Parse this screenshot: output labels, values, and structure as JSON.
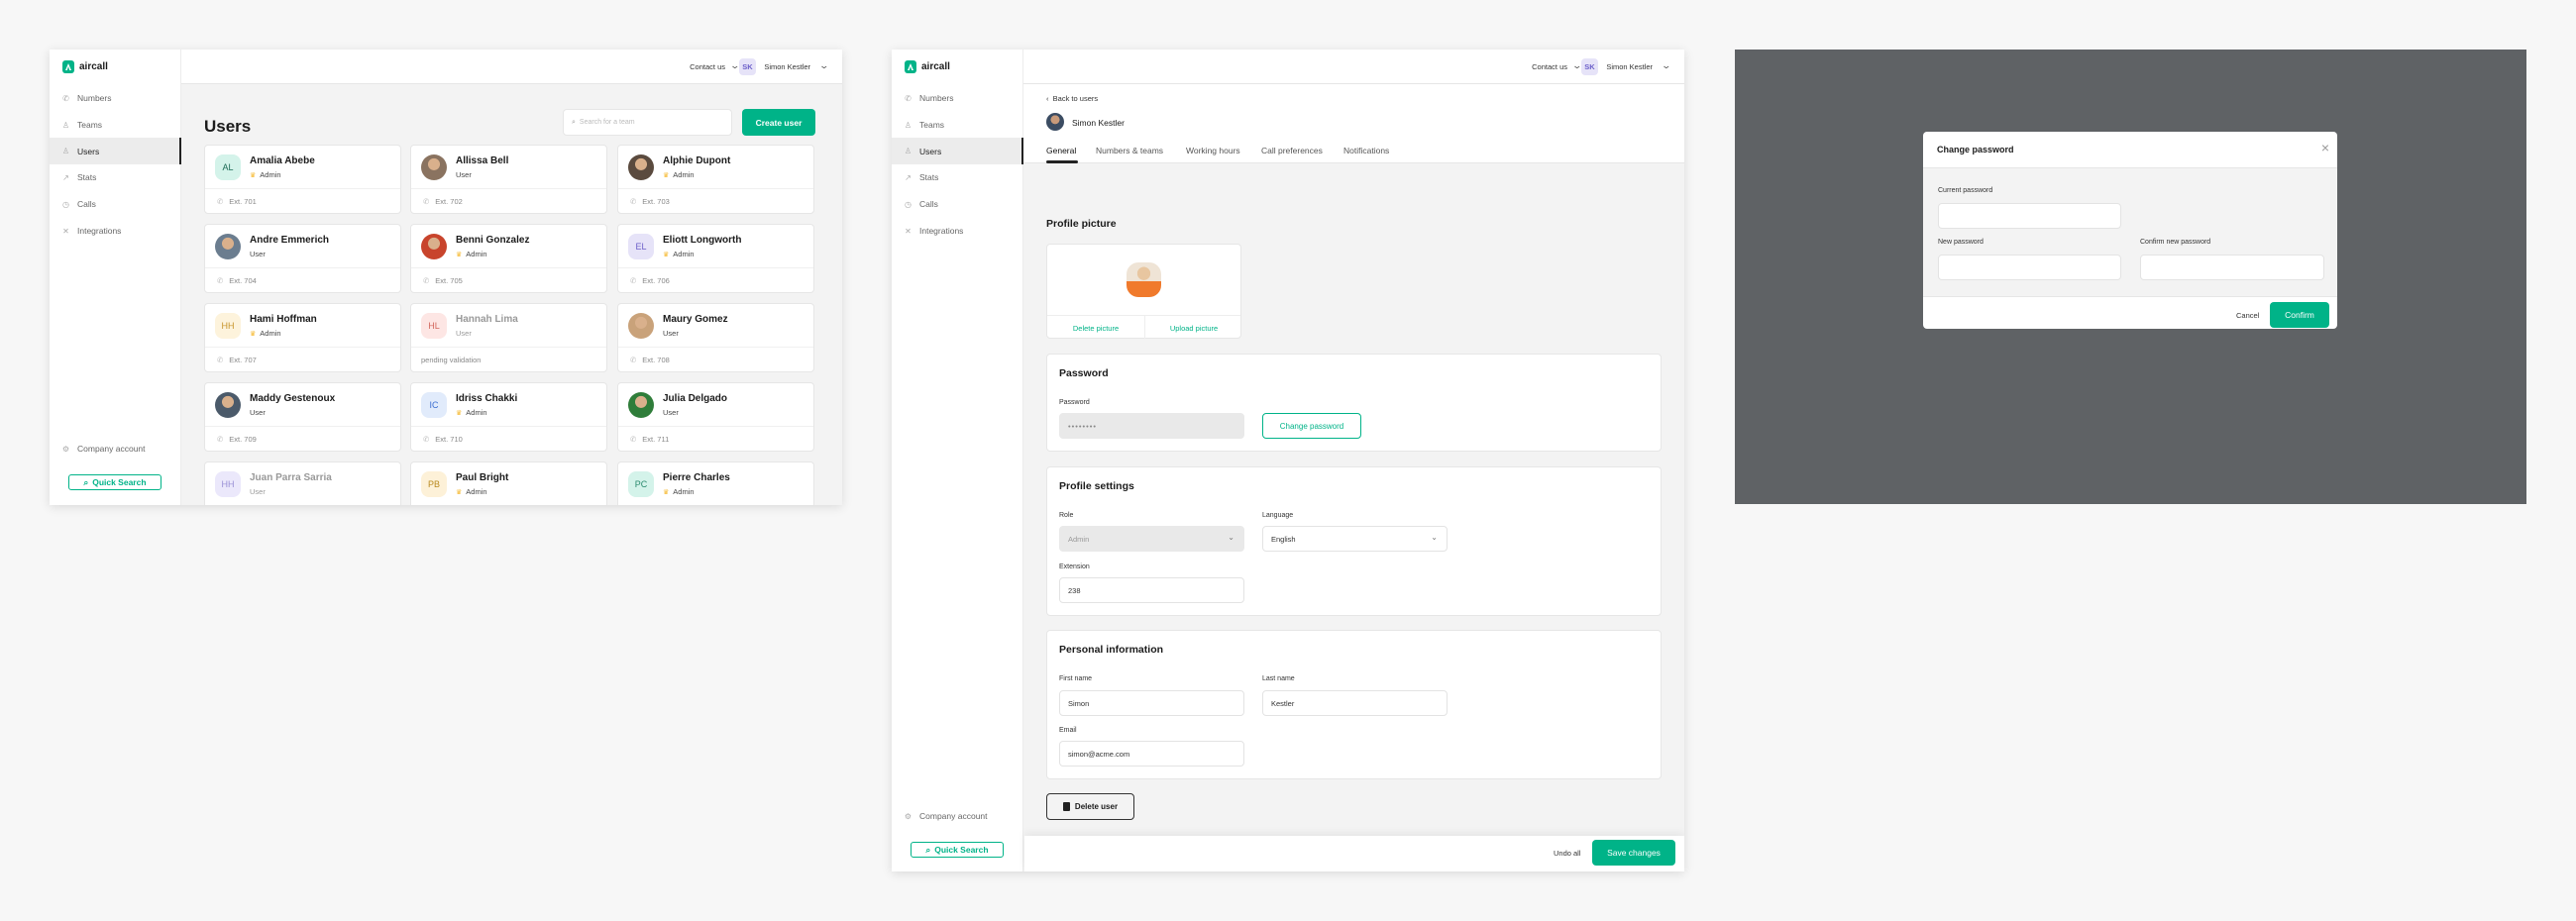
{
  "brand": {
    "name": "aircall",
    "accent": "#00b388"
  },
  "sidebar": {
    "items": [
      {
        "label": "Numbers",
        "icon": "phone-icon"
      },
      {
        "label": "Teams",
        "icon": "team-icon"
      },
      {
        "label": "Users",
        "icon": "user-icon",
        "active": true
      },
      {
        "label": "Stats",
        "icon": "chart-icon"
      },
      {
        "label": "Calls",
        "icon": "clock-icon"
      },
      {
        "label": "Integrations",
        "icon": "integrations-icon"
      }
    ],
    "company_account": "Company account",
    "quick_search": "Quick Search"
  },
  "header": {
    "contact": "Contact us",
    "user_initials": "SK",
    "user_name": "Simon Kestler"
  },
  "users_page": {
    "title": "Users",
    "search_placeholder": "Search for a team",
    "create_button": "Create user",
    "cards": [
      {
        "name": "Amalia Abebe",
        "role": "Admin",
        "admin": true,
        "ext": "Ext. 701",
        "initials": "AL",
        "bg": "#d4f3ea",
        "fg": "#1c6b55"
      },
      {
        "name": "Allissa Bell",
        "role": "User",
        "admin": false,
        "ext": "Ext. 702",
        "photo": "#8a7360"
      },
      {
        "name": "Alphie Dupont",
        "role": "Admin",
        "admin": true,
        "ext": "Ext. 703",
        "photo": "#5a4a3e"
      },
      {
        "name": "Andre Emmerich",
        "role": "User",
        "admin": false,
        "ext": "Ext. 704",
        "photo": "#6b7d8f"
      },
      {
        "name": "Benni Gonzalez",
        "role": "Admin",
        "admin": true,
        "ext": "Ext. 705",
        "photo": "#c8442c"
      },
      {
        "name": "Eliott Longworth",
        "role": "Admin",
        "admin": true,
        "ext": "Ext. 706",
        "initials": "EL",
        "bg": "#e6e3f8",
        "fg": "#6b5fc9"
      },
      {
        "name": "Hami Hoffman",
        "role": "Admin",
        "admin": true,
        "ext": "Ext. 707",
        "initials": "HH",
        "bg": "#fdf3dc",
        "fg": "#c8952c"
      },
      {
        "name": "Hannah Lima",
        "role": "User",
        "admin": false,
        "ext": "pending validation",
        "initials": "HL",
        "bg": "#fde6e4",
        "fg": "#d2685e",
        "pending": true
      },
      {
        "name": "Maury Gomez",
        "role": "User",
        "admin": false,
        "ext": "Ext. 708",
        "photo": "#c9a27a"
      },
      {
        "name": "Maddy Gestenoux",
        "role": "User",
        "admin": false,
        "ext": "Ext. 709",
        "photo": "#4b5a6a"
      },
      {
        "name": "Idriss Chakki",
        "role": "Admin",
        "admin": true,
        "ext": "Ext. 710",
        "initials": "IC",
        "bg": "#e1ebfb",
        "fg": "#3b6fd1"
      },
      {
        "name": "Julia Delgado",
        "role": "User",
        "admin": false,
        "ext": "Ext. 711",
        "photo": "#2f7d3a"
      },
      {
        "name": "Juan Parra Sarria",
        "role": "User",
        "admin": false,
        "ext": "",
        "initials": "HH",
        "bg": "#ebe8fb",
        "fg": "#9a90d6",
        "pending": true
      },
      {
        "name": "Paul Bright",
        "role": "Admin",
        "admin": true,
        "ext": "",
        "initials": "PB",
        "bg": "#fdf1d8",
        "fg": "#b98a20"
      },
      {
        "name": "Pierre Charles",
        "role": "Admin",
        "admin": true,
        "ext": "",
        "initials": "PC",
        "bg": "#d4f3ea",
        "fg": "#2a8a6e"
      }
    ]
  },
  "user_detail": {
    "back": "Back to users",
    "user_name": "Simon Kestler",
    "tabs": [
      "General",
      "Numbers & teams",
      "Working hours",
      "Call preferences",
      "Notifications"
    ],
    "active_tab": "General",
    "profile_picture": {
      "title": "Profile picture",
      "delete": "Delete picture",
      "upload": "Upload picture"
    },
    "password": {
      "title": "Password",
      "label": "Password",
      "value": "••••••••",
      "change_button": "Change password"
    },
    "profile_settings": {
      "title": "Profile settings",
      "role_label": "Role",
      "role_value": "Admin",
      "language_label": "Language",
      "language_value": "English",
      "extension_label": "Extension",
      "extension_value": "238"
    },
    "personal": {
      "title": "Personal information",
      "first_label": "First name",
      "first_value": "Simon",
      "last_label": "Last name",
      "last_value": "Kestler",
      "email_label": "Email",
      "email_value": "simon@acme.com"
    },
    "delete_button": "Delete user",
    "undo": "Undo all",
    "save": "Save changes"
  },
  "modal": {
    "title": "Change password",
    "current_label": "Current password",
    "new_label": "New password",
    "confirm_label": "Confirm new password",
    "cancel": "Cancel",
    "confirm": "Confirm"
  }
}
